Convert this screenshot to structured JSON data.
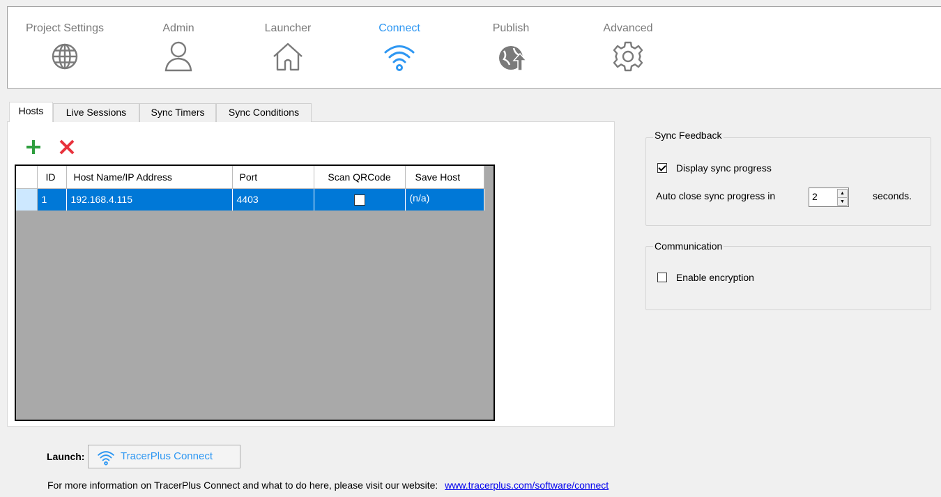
{
  "nav": {
    "items": [
      {
        "label": "Project Settings",
        "icon": "globe-icon"
      },
      {
        "label": "Admin",
        "icon": "user-icon"
      },
      {
        "label": "Launcher",
        "icon": "home-icon"
      },
      {
        "label": "Connect",
        "icon": "wifi-icon",
        "active": true
      },
      {
        "label": "Publish",
        "icon": "globe-upload-icon"
      },
      {
        "label": "Advanced",
        "icon": "gear-icon"
      }
    ],
    "active_color": "#2e97f2",
    "inactive_color": "#7a7a7a"
  },
  "tabs": [
    "Hosts",
    "Live Sessions",
    "Sync Timers",
    "Sync Conditions"
  ],
  "toolbar": {
    "add_icon": "plus-icon",
    "remove_icon": "x-icon"
  },
  "grid": {
    "columns": [
      "ID",
      "Host Name/IP Address",
      "Port",
      "Scan QRCode",
      "Save Host"
    ],
    "rows": [
      {
        "id": "1",
        "host": "192.168.4.115",
        "port": "4403",
        "scan_qr": false,
        "save_host": "(n/a)"
      }
    ],
    "selection_color": "#0078d7"
  },
  "sync_feedback": {
    "title": "Sync Feedback",
    "display_progress_label": "Display sync progress",
    "display_progress_checked": true,
    "auto_close_label": "Auto close sync progress in",
    "auto_close_value": "2",
    "seconds_label": "seconds."
  },
  "communication": {
    "title": "Communication",
    "encryption_label": "Enable encryption",
    "encryption_checked": false
  },
  "launch": {
    "label": "Launch:",
    "button_label": "TracerPlus Connect",
    "button_icon": "wifi-icon"
  },
  "info": {
    "text": "For more information on TracerPlus Connect and what to do here, please visit our website:",
    "link": "www.tracerplus.com/software/connect"
  }
}
